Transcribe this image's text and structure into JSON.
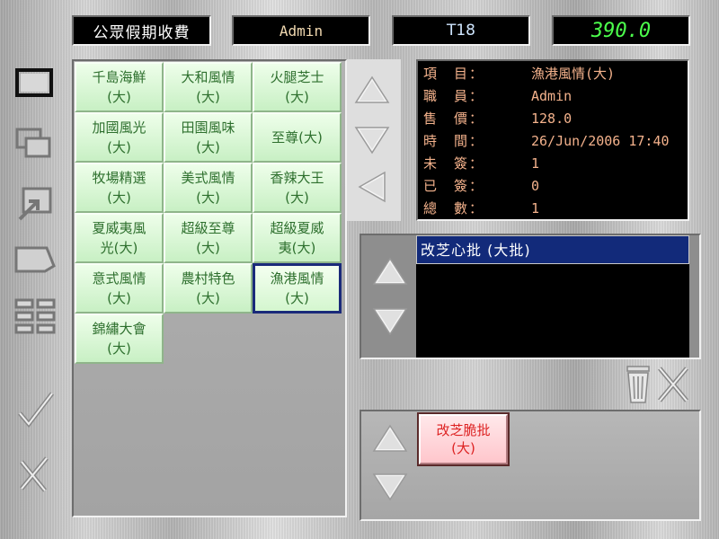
{
  "top_bar": {
    "title": "公眾假期收費",
    "user": "Admin",
    "table": "T18",
    "amount": "390.0"
  },
  "menu_items": [
    {
      "name": "千島海鮮\n(大)"
    },
    {
      "name": "大和風情\n(大)"
    },
    {
      "name": "火腿芝士\n(大)"
    },
    {
      "name": "加國風光\n(大)"
    },
    {
      "name": "田園風味\n(大)"
    },
    {
      "name": "至尊(大)"
    },
    {
      "name": "牧場精選\n(大)"
    },
    {
      "name": "美式風情\n(大)"
    },
    {
      "name": "香辣大王\n(大)"
    },
    {
      "name": "夏威夷風\n光(大)"
    },
    {
      "name": "超級至尊\n(大)"
    },
    {
      "name": "超級夏威\n夷(大)"
    },
    {
      "name": "意式風情\n(大)"
    },
    {
      "name": "農村特色\n(大)"
    },
    {
      "name": "漁港風情\n(大)",
      "selected": true
    },
    {
      "name": "錦繡大會\n(大)"
    }
  ],
  "info": {
    "rows": [
      {
        "label": "項　目：",
        "value": "漁港風情(大)"
      },
      {
        "label": "職　員：",
        "value": "Admin"
      },
      {
        "label": "售　價：",
        "value": "128.0"
      },
      {
        "label": "時　間：",
        "value": "26/Jun/2006 17:40"
      },
      {
        "label": "未　簽：",
        "value": "1"
      },
      {
        "label": "已　簽：",
        "value": "0"
      },
      {
        "label": "總　數：",
        "value": "1"
      }
    ]
  },
  "modifier_list": {
    "rows": [
      "改芝心批 (大批)"
    ]
  },
  "bottom_options": {
    "button": "改芝脆批\n(大)"
  },
  "colors": {
    "item_text": "#2d6f2d",
    "info_text": "#f4b28c",
    "amount": "#4cff4c",
    "selection": "#122a7a",
    "pink_text": "#dd2222"
  },
  "icons": [
    "window-icon",
    "cascade-icon",
    "resize-icon",
    "tag-icon",
    "grid-icon",
    "check-icon",
    "cancel-x-icon",
    "trash-icon",
    "close-x-icon"
  ]
}
